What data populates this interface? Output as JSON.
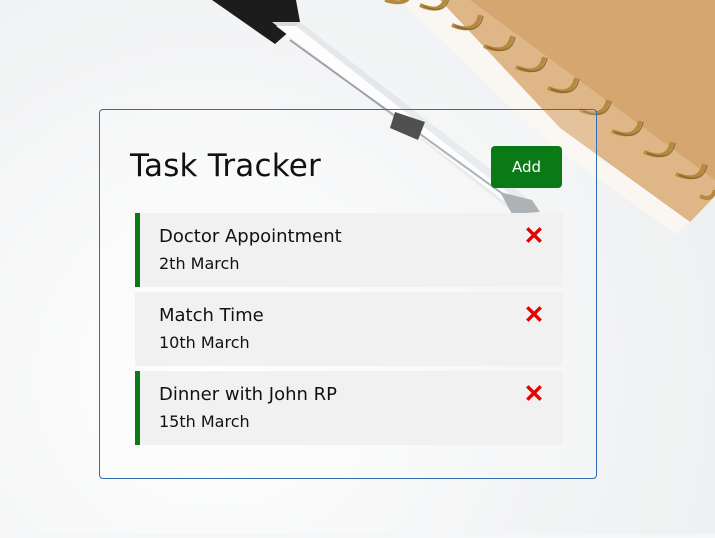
{
  "app": {
    "title": "Task Tracker",
    "add_button_label": "Add"
  },
  "colors": {
    "accent_green": "#0a7a16",
    "delete_red": "#e60000",
    "container_border": "#2f6fb1"
  },
  "tasks": [
    {
      "text": "Doctor Appointment",
      "day": "2th March",
      "reminder": true,
      "delete_icon": "close-x-icon"
    },
    {
      "text": "Match Time",
      "day": "10th March",
      "reminder": false,
      "delete_icon": "close-x-icon"
    },
    {
      "text": "Dinner with John RP",
      "day": "15th March",
      "reminder": true,
      "delete_icon": "close-x-icon"
    }
  ]
}
